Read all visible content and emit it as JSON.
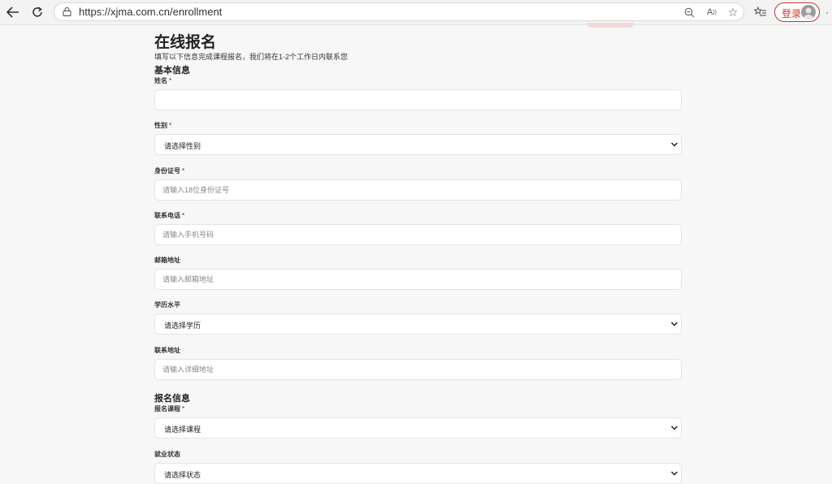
{
  "browser": {
    "url": "https://xjma.com.cn/enrollment",
    "login_label": "登录",
    "more_label": "·"
  },
  "form": {
    "title": "在线报名",
    "subtitle": "填写以下信息完成课程报名，我们将在1-2个工作日内联系您",
    "section_basic": "基本信息",
    "section_enroll": "报名信息",
    "fields": {
      "name": {
        "label": "姓名",
        "required": "*",
        "value": "",
        "placeholder": ""
      },
      "gender": {
        "label": "性别",
        "required": "*",
        "selected": "请选择性别"
      },
      "id_number": {
        "label": "身份证号",
        "required": "*",
        "placeholder": "请输入18位身份证号"
      },
      "phone": {
        "label": "联系电话",
        "required": "*",
        "placeholder": "请输入手机号码"
      },
      "email": {
        "label": "邮箱地址",
        "placeholder": "请输入邮箱地址"
      },
      "education": {
        "label": "学历水平",
        "selected": "请选择学历"
      },
      "address": {
        "label": "联系地址",
        "placeholder": "请输入详细地址"
      },
      "course": {
        "label": "报名课程",
        "required": "*",
        "selected": "请选择课程"
      },
      "employment": {
        "label": "就业状态",
        "selected": "请选择状态"
      }
    }
  }
}
